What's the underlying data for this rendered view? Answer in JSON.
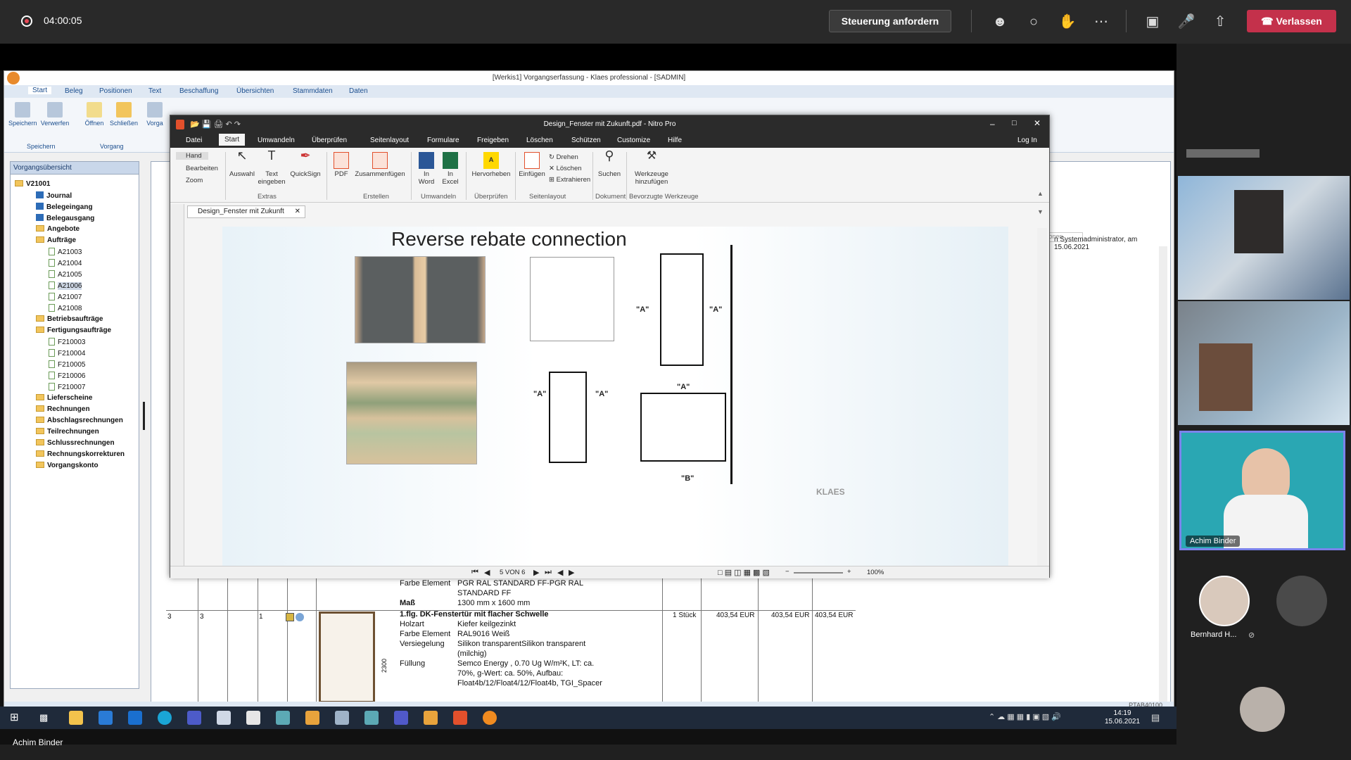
{
  "meeting": {
    "recording_time": "04:00:05",
    "control_button": "Steuerung anfordern",
    "leave_button": "Verlassen",
    "presenter_name": "Achim Binder"
  },
  "klaes": {
    "title": "[Werkis1] Vorgangserfassung - Klaes professional - [SADMIN]",
    "tabs": [
      "Start",
      "Beleg",
      "Positionen",
      "Text",
      "Beschaffung",
      "Übersichten",
      "Stammdaten",
      "Daten"
    ],
    "ribbon_buttons": [
      "Speichern",
      "Verwerfen",
      "Öffnen",
      "Schließen",
      "Vorga"
    ],
    "ribbon_groups": [
      "Speichern",
      "Vorgang"
    ],
    "sysadmin_note": "n Systemadministrator, am 15.06.2021",
    "options_label": "Optionen",
    "panel_title": "Vorgangsübersicht",
    "tree": {
      "root": "V21001",
      "journal": "Journal",
      "belegeingang": "Belegeingang",
      "belegausgang": "Belegausgang",
      "angebote": "Angebote",
      "auftraege": "Aufträge",
      "auftrag_items": [
        "A21003",
        "A21004",
        "A21005",
        "A21006",
        "A21007",
        "A21008"
      ],
      "betriebsauftraege": "Betriebsaufträge",
      "fertigungsauftraege": "Fertigungsaufträge",
      "fertigung_items": [
        "F210003",
        "F210004",
        "F210005",
        "F210006",
        "F210007"
      ],
      "rest": [
        "Lieferscheine",
        "Rechnungen",
        "Abschlagsrechnungen",
        "Teilrechnungen",
        "Schlussrechnungen",
        "Rechnungskorrekturen",
        "Vorgangskonto"
      ]
    },
    "rows": {
      "farbe_label": "Farbe Element",
      "farbe_value_1": "PGR RAL STANDARD FF-PGR RAL",
      "farbe_value_2": "STANDARD FF",
      "mass_label": "Maß",
      "mass_value": "1300 mm x 1600 mm",
      "pos": "3",
      "pos2": "3",
      "qty_index": "1",
      "item_title": "1.flg. DK-Fenstertür mit flacher Schwelle",
      "holzart_label": "Holzart",
      "holzart_value": "Kiefer keilgezinkt",
      "farbe2_value": "RAL9016 Weiß",
      "versiegelung_label": "Versiegelung",
      "versiegelung_value_1": "Silikon transparentSilikon transparent",
      "versiegelung_value_2": "(milchig)",
      "fuellung_label": "Füllung",
      "fuellung_value_1": "Semco Energy , 0.70 Ug W/m²K, LT: ca.",
      "fuellung_value_2": "70%, g-Wert: ca. 50%, Aufbau:",
      "fuellung_value_3": "Float4b/12/Float4/12/Float4b, TGI_Spacer",
      "quantity": "1 Stück",
      "price1": "403,54 EUR",
      "price2": "403,54 EUR",
      "price3": "403,54 EUR",
      "dimension_label": "2300"
    },
    "status_code": "PTAB40100"
  },
  "nitro": {
    "title": "Design_Fenster mit Zukunft.pdf - Nitro Pro",
    "menu": [
      "Datei",
      "Start",
      "Umwandeln",
      "Überprüfen",
      "Seitenlayout",
      "Formulare",
      "Freigeben",
      "Löschen",
      "Schützen",
      "Customize",
      "Hilfe"
    ],
    "login": "Log In",
    "tools": [
      "Hand",
      "Bearbeiten",
      "Zoom"
    ],
    "buttons": {
      "auswahl": "Auswahl",
      "text": "Text\neingeben",
      "quicksign": "QuickSign",
      "pdf": "PDF",
      "zusammen": "Zusammenfügen",
      "word": "In\nWord",
      "excel": "In\nExcel",
      "hervorheben": "Hervorheben",
      "einfuegen": "Einfügen",
      "drehen": "Drehen",
      "loeschen": "Löschen",
      "extrahieren": "Extrahieren",
      "suchen": "Suchen",
      "werkzeuge": "Werkzeuge\nhinzufügen"
    },
    "groups": [
      "Extras",
      "Erstellen",
      "Umwandeln",
      "Überprüfen",
      "Seitenlayout",
      "Dokument",
      "Bevorzugte Werkzeuge"
    ],
    "doc_tab": "Design_Fenster mit Zukunft",
    "slide_title": "Reverse rebate connection",
    "page_indicator": "5 VON 6",
    "zoom": "100%",
    "drawing_labels": {
      "a": "\"A\"",
      "b": "\"B\"",
      "logo": "KLAES"
    }
  },
  "taskbar": {
    "time": "14:19",
    "date": "15.06.2021"
  },
  "participants": {
    "active_name": "Achim Binder",
    "other_name": "Bernhard H..."
  },
  "colors": {
    "leave": "#c4314b",
    "teams_bar": "#292929",
    "klaes_blue": "#1c4f8f"
  }
}
